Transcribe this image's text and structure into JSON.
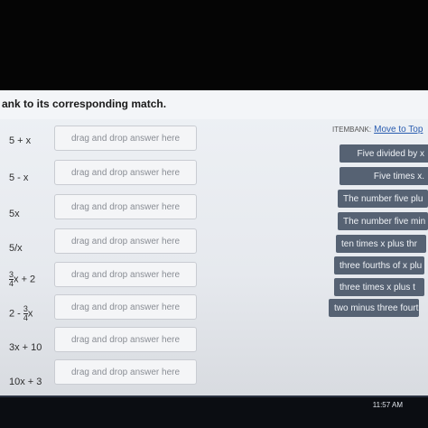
{
  "instruction": "ank to its corresponding match.",
  "prompts": [
    {
      "text": "5 + x"
    },
    {
      "text": "5 - x"
    },
    {
      "text": "5x"
    },
    {
      "text": "5/x"
    },
    {
      "pre": "",
      "num": "3",
      "den": "4",
      "post": "x + 2"
    },
    {
      "pre": "2 - ",
      "num": "3",
      "den": "4",
      "post": "x"
    },
    {
      "text": "3x + 10"
    },
    {
      "text": "10x + 3"
    }
  ],
  "dropzone_label": "drag and drop answer here",
  "itembank": {
    "label": "ITEMBANK:",
    "move_link": "Move to Top",
    "items": [
      "Five divided by x",
      "Five times x.",
      "The number five plu",
      "The number five min",
      "ten times x plus thr",
      "three fourths of x plu",
      "three times x plus t",
      "two minus three fourth"
    ]
  },
  "taskbar": {
    "time": "11:57 AM"
  }
}
